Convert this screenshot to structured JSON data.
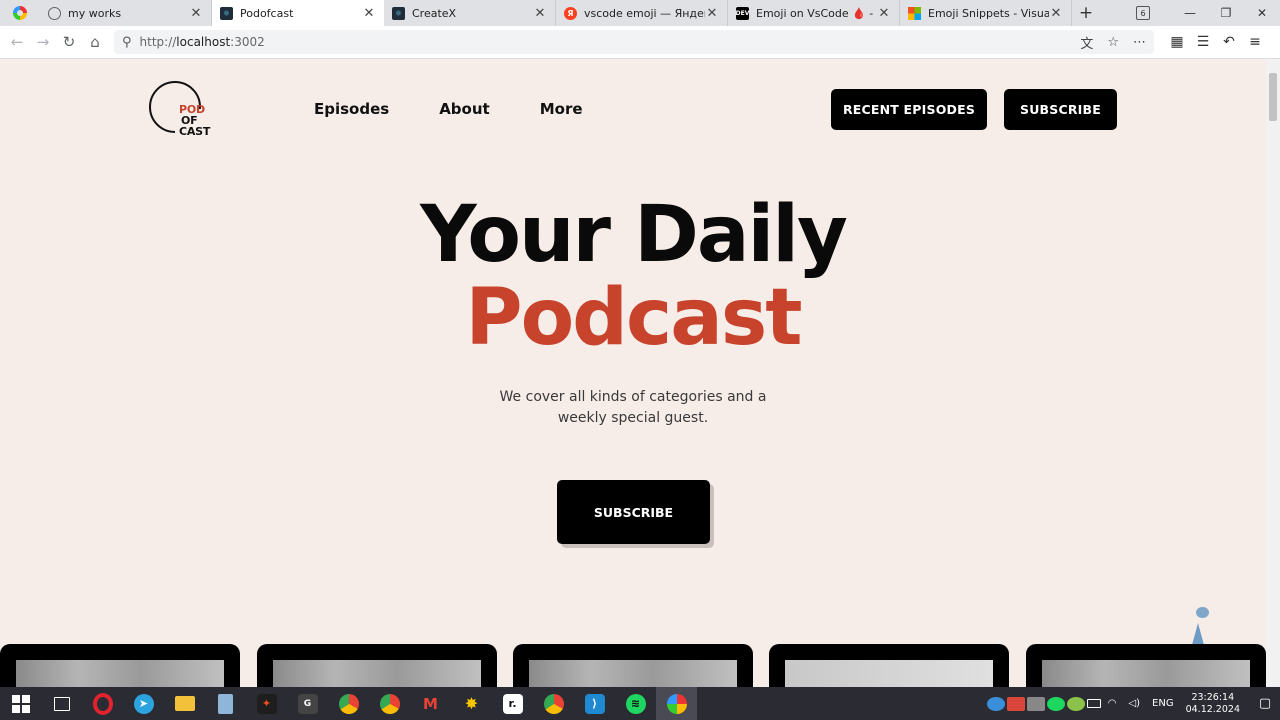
{
  "browser": {
    "tabs": [
      {
        "title": "my works",
        "icon": "globe-icon",
        "color": "#5f6368"
      },
      {
        "title": "Podofcast",
        "icon": "react-icon",
        "color": "#1f2d3a",
        "active": true
      },
      {
        "title": "CreateX",
        "icon": "react-icon",
        "color": "#1f2d3a"
      },
      {
        "title": "vscode emoji — Яндекс: на",
        "icon": "yandex-icon",
        "color": "#fc3f1d"
      },
      {
        "title": "Emoji on VsCode 🩸 - DEV",
        "icon": "dev-icon",
        "color": "#000000"
      },
      {
        "title": "Emoji Snippets - Visual Stu",
        "icon": "microsoft-icon",
        "color": "#f25022"
      }
    ],
    "tab_count": "6",
    "url_prefix": "http://",
    "url_host": "localhost",
    "url_port": ":3002"
  },
  "site": {
    "logo": {
      "line1": "POD",
      "line2": "OF",
      "line3": "CAST"
    },
    "nav": [
      "Episodes",
      "About",
      "More"
    ],
    "recent_button": "RECENT EPISODES",
    "subscribe_top": "SUBSCRIBE",
    "hero_line1": "Your Daily",
    "hero_line2": "Podcast",
    "hero_sub_line1": "We cover all kinds of categories and a",
    "hero_sub_line2": "weekly special guest.",
    "subscribe_main": "SUBSCRIBE",
    "accent_color": "#c8432b",
    "background_color": "#f6ece8"
  },
  "taskbar": {
    "apps": [
      "windows-start-icon",
      "task-view-icon",
      "opera-icon",
      "telegram-icon",
      "file-explorer-icon",
      "notepad-icon",
      "figma-icon",
      "g-app-icon",
      "chrome-user-icon",
      "chrome-user2-icon",
      "gmail-icon",
      "spark-icon",
      "r-app-icon",
      "chrome-icon",
      "vscode-icon",
      "spotify-icon",
      "browser-icon"
    ],
    "language": "ENG",
    "time": "23:26:14",
    "date": "04.12.2024",
    "notifications": "1"
  }
}
